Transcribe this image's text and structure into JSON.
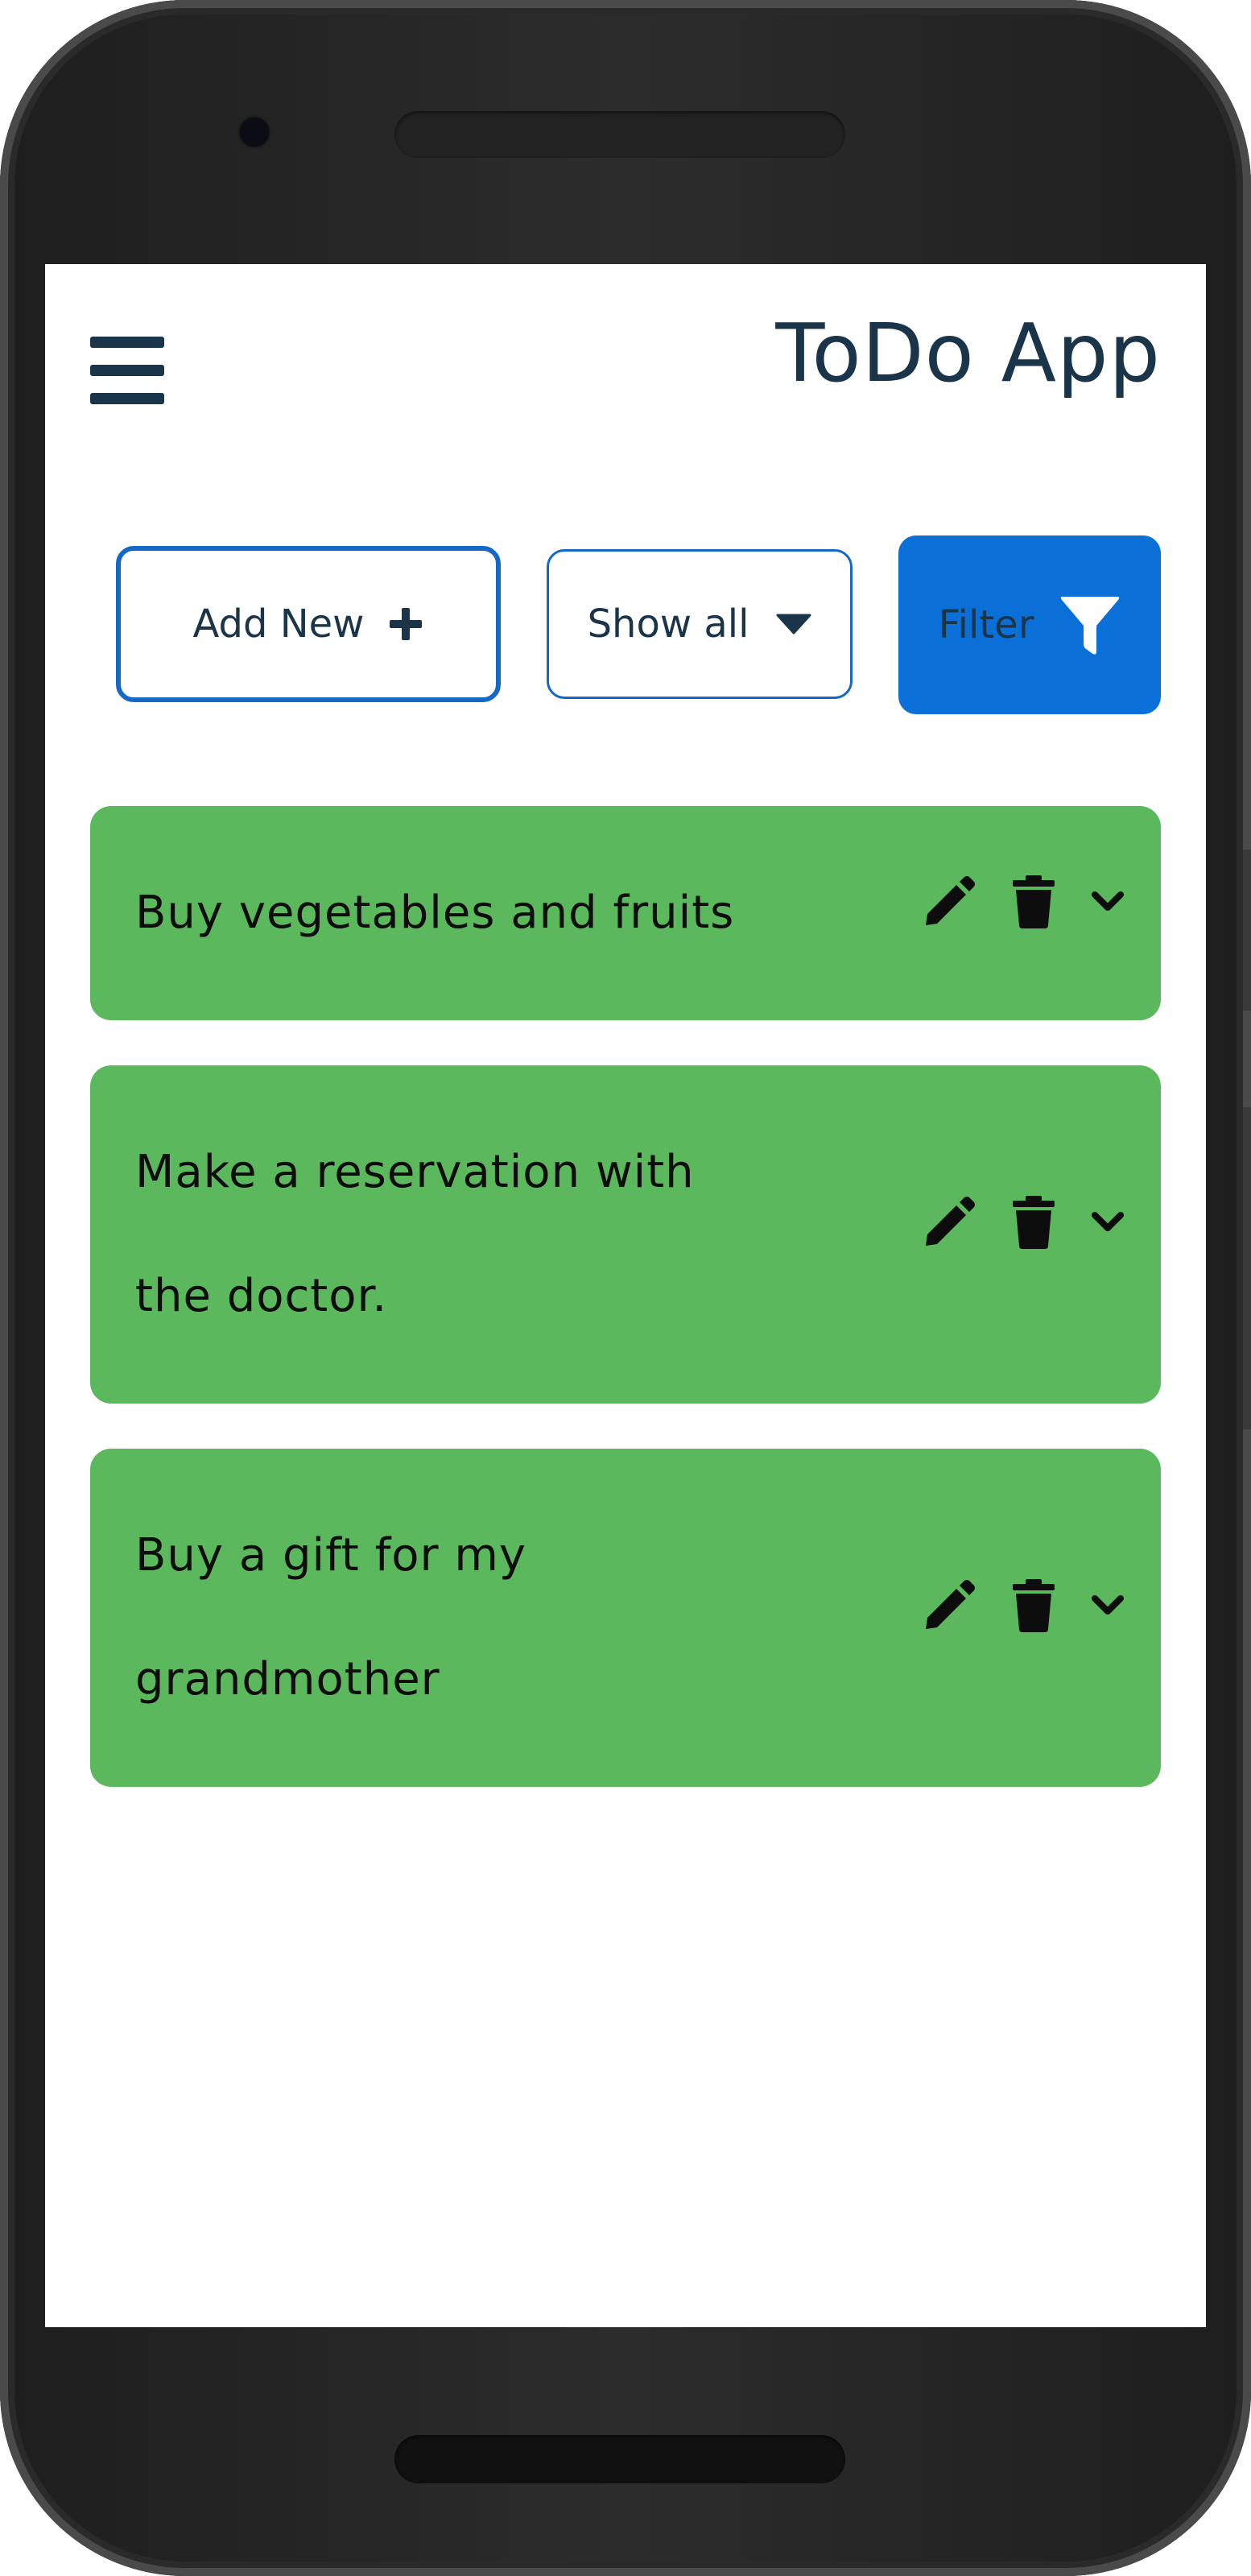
{
  "app": {
    "title": "ToDo App"
  },
  "toolbar": {
    "add_new_label": "Add New",
    "show_all_label": "Show all",
    "filter_label": "Filter"
  },
  "todos": [
    {
      "text": "Buy vegetables and fruits"
    },
    {
      "text": "Make a reservation with the doctor."
    },
    {
      "text": "Buy a gift for my grandmother"
    }
  ],
  "icons": {
    "menu": "hamburger-menu-icon",
    "add": "plus-icon",
    "dropdown": "caret-down-icon",
    "filter": "funnel-icon",
    "edit": "pencil-icon",
    "delete": "trash-icon",
    "expand": "chevron-down-icon"
  },
  "colors": {
    "primary": "#0b6fd8",
    "todo_background": "#5cb85c",
    "title_text": "#1a3449"
  }
}
